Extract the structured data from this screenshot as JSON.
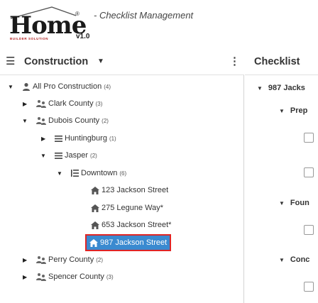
{
  "header": {
    "logo_text": "Home",
    "logo_subtext": "BUILDER SOLUTION",
    "logo_registered": "®",
    "version": "v1.0",
    "app_title": "- Checklist Management"
  },
  "left_panel": {
    "menu_icon": "hamburger-icon",
    "title": "Construction",
    "title_caret": "▼",
    "more_icon": "kebab-icon",
    "tree": {
      "root": {
        "label": "All Pro Construction",
        "count": "(4)",
        "caret": "▼"
      },
      "clark": {
        "label": "Clark County",
        "count": "(3)",
        "caret": "▶"
      },
      "dubois": {
        "label": "Dubois County",
        "count": "(2)",
        "caret": "▼"
      },
      "huntingburg": {
        "label": "Huntingburg",
        "count": "(1)",
        "caret": "▶"
      },
      "jasper": {
        "label": "Jasper",
        "count": "(2)",
        "caret": "▼"
      },
      "downtown": {
        "label": "Downtown",
        "count": "(6)",
        "caret": "▼"
      },
      "lot1": {
        "label": "123 Jackson Street"
      },
      "lot2": {
        "label": "275 Legune Way*"
      },
      "lot3": {
        "label": "653 Jackson Street*"
      },
      "lot4": {
        "label": "987 Jackson Street"
      },
      "perry": {
        "label": "Perry County",
        "count": "(2)",
        "caret": "▶"
      },
      "spencer": {
        "label": "Spencer County",
        "count": "(3)",
        "caret": "▶"
      }
    }
  },
  "right_panel": {
    "title": "Checklist",
    "item_main": {
      "caret": "▼",
      "label": "987 Jacks"
    },
    "item_prep": {
      "caret": "▼",
      "label": "Prep"
    },
    "item_foun": {
      "caret": "▼",
      "label": "Foun"
    },
    "item_conc": {
      "caret": "▼",
      "label": "Conc"
    }
  },
  "colors": {
    "selection": "#3a8ad0",
    "selection_outline": "#e02424",
    "logo_accent": "#b02020"
  }
}
